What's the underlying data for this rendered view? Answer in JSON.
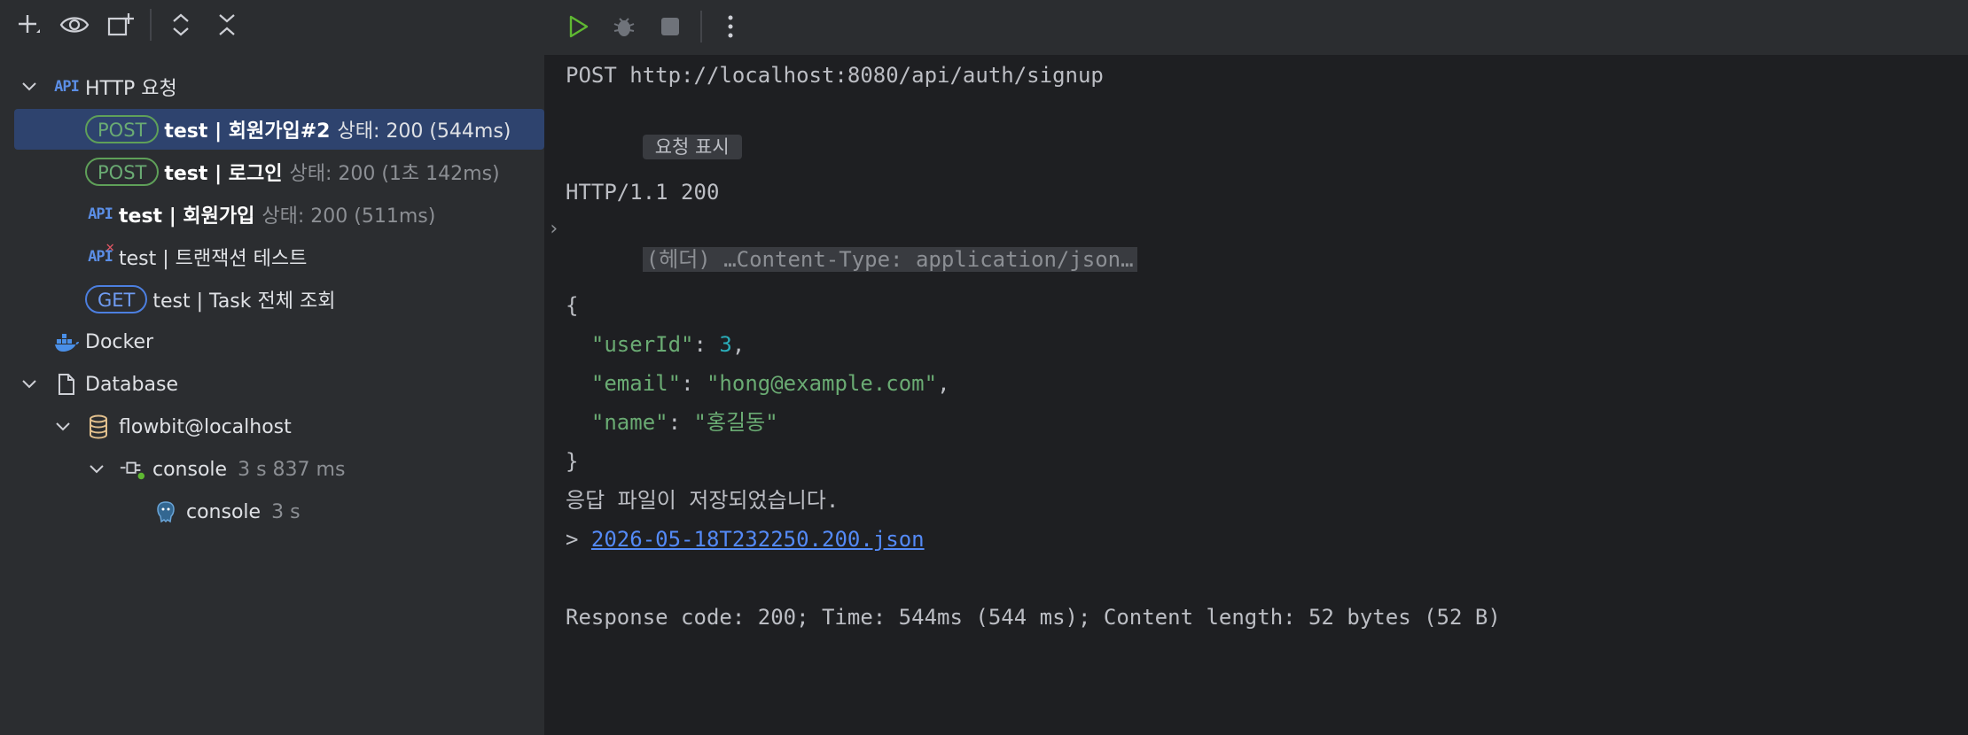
{
  "left_toolbar": {
    "icons": [
      "add-icon",
      "eye-icon",
      "new-window-icon",
      "expand-all-icon",
      "collapse-all-icon"
    ]
  },
  "tree": {
    "http_group": {
      "label": "HTTP 요청"
    },
    "items": [
      {
        "method": "POST",
        "name": "test  |  회원가입#2",
        "status": "상태: 200 (544ms)"
      },
      {
        "method": "POST",
        "name": "test  |  로그인",
        "status": "상태: 200 (1초 142ms)"
      },
      {
        "method": "",
        "name": "test | 회원가입",
        "status": "상태: 200 (511ms)"
      },
      {
        "method": "",
        "name": "test | 트랜잭션 테스트",
        "status": ""
      },
      {
        "method": "GET",
        "name": "test  |  Task 전체 조회",
        "status": ""
      }
    ],
    "docker": {
      "label": "Docker"
    },
    "database": {
      "label": "Database"
    },
    "datasource": {
      "label": "flowbit@localhost"
    },
    "console_session": {
      "label": "console",
      "time": "3 s 837 ms"
    },
    "console_child": {
      "label": "console",
      "time": "3 s"
    }
  },
  "console": {
    "request_line": "POST http://localhost:8080/api/auth/signup",
    "show_request_label": "요청 표시",
    "status_line": "HTTP/1.1 200",
    "headers_collapsed": "(헤더) …Content-Type: application/json…",
    "json": {
      "open": "{",
      "userId_key": "\"userId\"",
      "userId_val": "3",
      "email_key": "\"email\"",
      "email_val": "\"hong@example.com\"",
      "name_key": "\"name\"",
      "name_val": "\"홍길동\"",
      "close": "}"
    },
    "saved_msg": "응답 파일이 저장되었습니다.",
    "file_prefix": "> ",
    "file_link": "2026-05-18T232250.200.json",
    "summary": "Response code: 200; Time: 544ms (544 ms); Content length: 52 bytes (52 B)"
  },
  "colors": {
    "selected_row": "#2e436e",
    "post_badge": "#6aab73",
    "get_badge": "#6f9cf2",
    "link": "#548af7",
    "number": "#2aacb8",
    "string": "#6aab73"
  }
}
